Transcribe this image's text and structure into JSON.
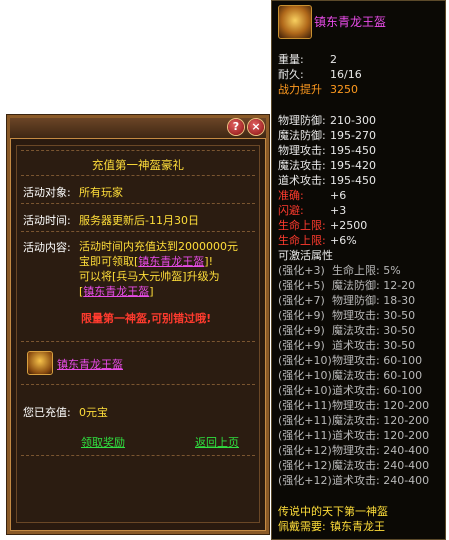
{
  "panel": {
    "help_glyph": "?",
    "close_glyph": "×",
    "title": "充值第一神盔豪礼",
    "target_label": "活动对象:",
    "target_value": "所有玩家",
    "time_label": "活动时间:",
    "time_value": "服务器更新后-11月30日",
    "content_label": "活动内容:",
    "content_line1": "活动时间内充值达到2000000元",
    "content_line2a": "宝即可领取[",
    "content_line2b": "镇东青龙王盔",
    "content_line2c": "]!",
    "content_line3": "可以将[兵马大元帅盔]升级为",
    "content_line4a": "[",
    "content_line4b": "镇东青龙王盔",
    "content_line4c": "]",
    "limited_text": "限量第一神盔,可别错过哦!",
    "reward_item_name": "镇东青龙王盔",
    "recharged_label": "您已充值:",
    "recharged_value": "0元宝",
    "claim_link": "领取奖励",
    "back_link": "返回上页"
  },
  "tooltip": {
    "item_name": "镇东青龙王盔",
    "weight_label": "重量:",
    "weight_value": "2",
    "durability_label": "耐久:",
    "durability_value": "16/16",
    "power_label": "战力提升",
    "power_value": "3250",
    "stats": [
      {
        "label": "物理防御:",
        "value": "210-300"
      },
      {
        "label": "魔法防御:",
        "value": "195-270"
      },
      {
        "label": "物理攻击:",
        "value": "195-450"
      },
      {
        "label": "魔法攻击:",
        "value": "195-420"
      },
      {
        "label": "道术攻击:",
        "value": "195-450"
      }
    ],
    "bonus": [
      {
        "label": "准确:",
        "value": "+6"
      },
      {
        "label": "闪避:",
        "value": "+3"
      },
      {
        "label": "生命上限:",
        "value": "+2500"
      },
      {
        "label": "生命上限:",
        "value": "+6%"
      }
    ],
    "activatable_label": "可激活属性",
    "enhance": [
      {
        "level": "(强化+3)",
        "attr": "生命上限: 5%"
      },
      {
        "level": "(强化+5)",
        "attr": "魔法防御: 12-20"
      },
      {
        "level": "(强化+7)",
        "attr": "物理防御: 18-30"
      },
      {
        "level": "(强化+9)",
        "attr": "物理攻击: 30-50"
      },
      {
        "level": "(强化+9)",
        "attr": "魔法攻击: 30-50"
      },
      {
        "level": "(强化+9)",
        "attr": "道术攻击: 30-50"
      },
      {
        "level": "(强化+10)",
        "attr": "物理攻击: 60-100"
      },
      {
        "level": "(强化+10)",
        "attr": "魔法攻击: 60-100"
      },
      {
        "level": "(强化+10)",
        "attr": "道术攻击: 60-100"
      },
      {
        "level": "(强化+11)",
        "attr": "物理攻击: 120-200"
      },
      {
        "level": "(强化+11)",
        "attr": "魔法攻击: 120-200"
      },
      {
        "level": "(强化+11)",
        "attr": "道术攻击: 120-200"
      },
      {
        "level": "(强化+12)",
        "attr": "物理攻击: 240-400"
      },
      {
        "level": "(强化+12)",
        "attr": "魔法攻击: 240-400"
      },
      {
        "level": "(强化+12)",
        "attr": "道术攻击: 240-400"
      }
    ],
    "legend_text": "传说中的天下第一神盔",
    "wear_label": "佩戴需要:",
    "wear_value": "镇东青龙王"
  }
}
